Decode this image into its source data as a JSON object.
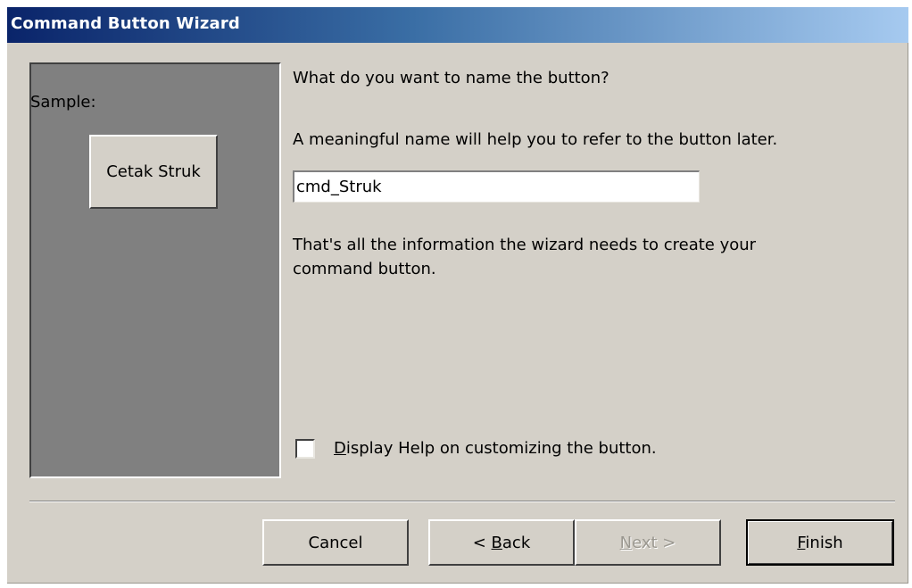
{
  "window": {
    "title": "Command Button Wizard"
  },
  "sample": {
    "label": "Sample:",
    "button_caption": "Cetak Struk"
  },
  "main": {
    "question": "What do you want to name the button?",
    "hint": "A meaningful name will help you to refer to the button later.",
    "name_value": "cmd_Struk",
    "info_line1": "That's all the information the wizard needs to create your",
    "info_line2": "command button."
  },
  "help_checkbox": {
    "checked": false,
    "label_mnemonic": "D",
    "label_rest": "isplay Help on customizing the button."
  },
  "buttons": {
    "cancel": "Cancel",
    "back_prefix": "< ",
    "back_mnemonic": "B",
    "back_rest": "ack",
    "next_mnemonic": "N",
    "next_rest": "ext >",
    "finish_mnemonic": "F",
    "finish_rest": "inish"
  }
}
